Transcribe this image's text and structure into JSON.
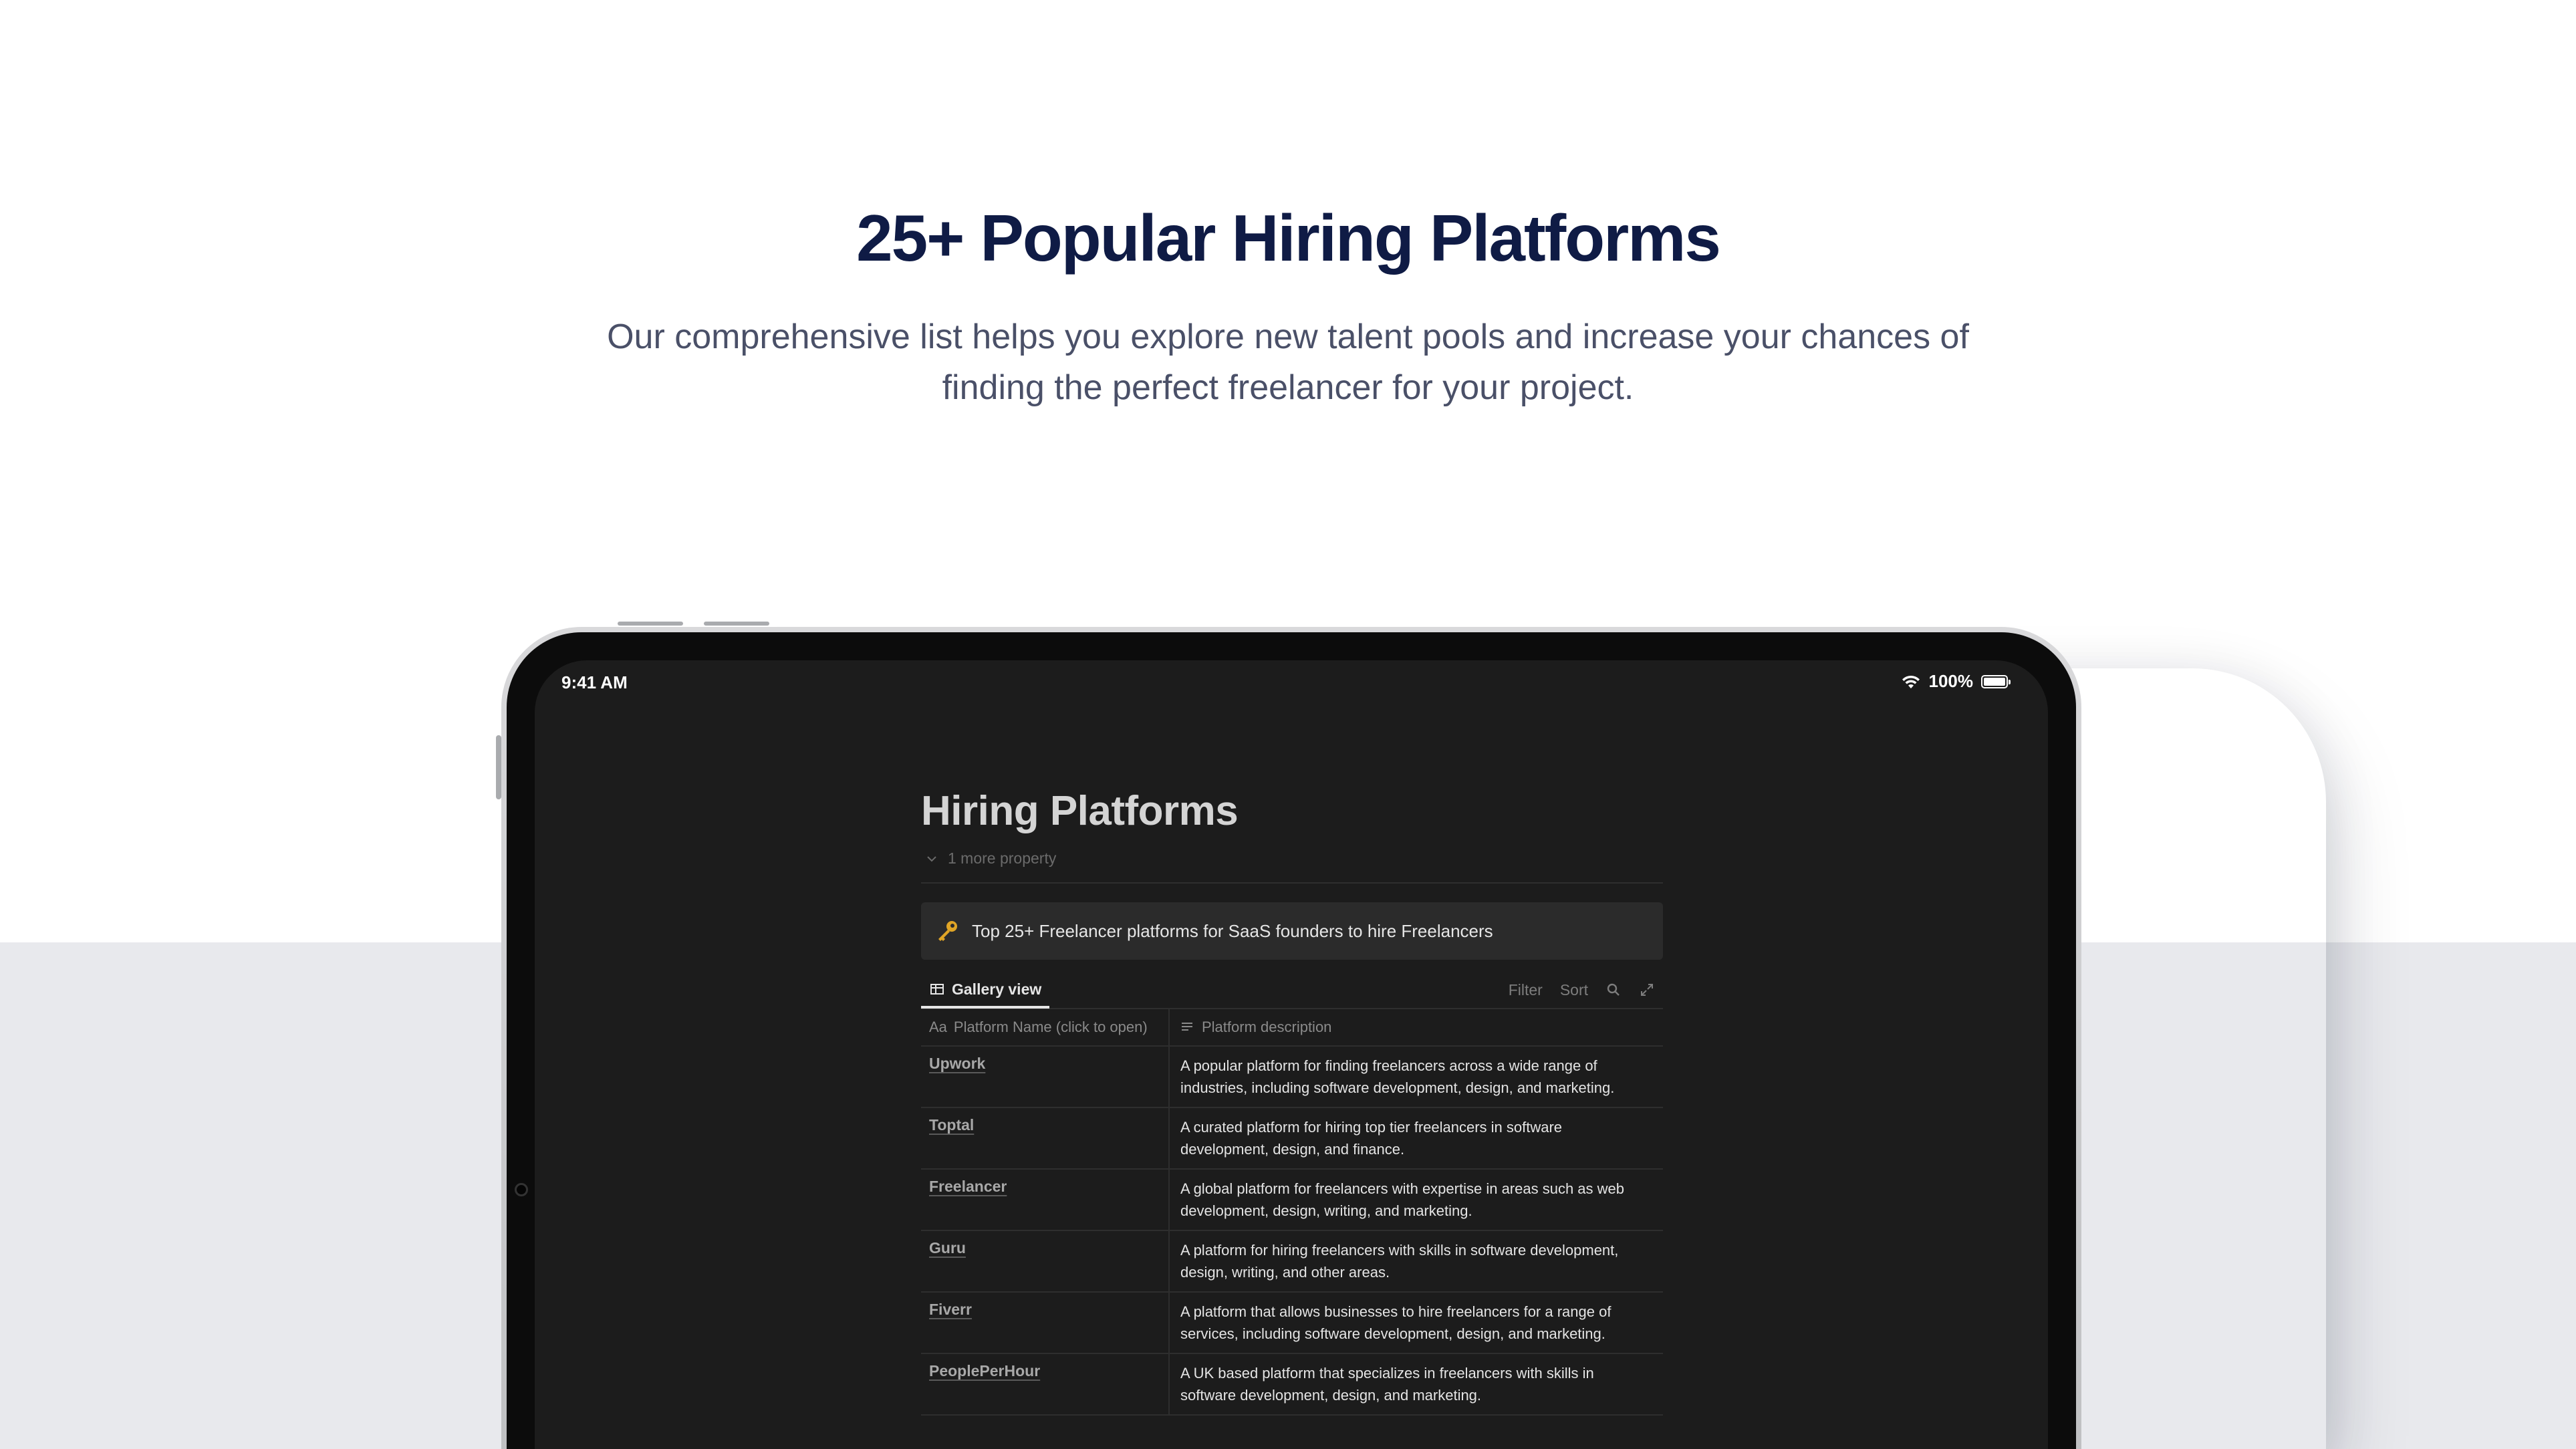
{
  "hero": {
    "title": "25+ Popular Hiring Platforms",
    "subtitle": "Our comprehensive list helps you explore new talent pools and increase your chances of finding the perfect freelancer for your project."
  },
  "status_bar": {
    "time": "9:41 AM",
    "battery": "100%"
  },
  "notion_page": {
    "title": "Hiring Platforms",
    "more_property": "1 more property",
    "callout": "Top 25+ Freelancer platforms for SaaS founders to hire Freelancers",
    "view_tab": "Gallery view",
    "actions": {
      "filter": "Filter",
      "sort": "Sort"
    },
    "columns": {
      "name_prefix": "Aa",
      "name": "Platform Name (click to open)",
      "description": "Platform description"
    },
    "rows": [
      {
        "name": "Upwork",
        "description": " A popular platform for finding freelancers across a wide range of industries, including software development, design, and marketing."
      },
      {
        "name": "Toptal",
        "description": " A curated platform for hiring top tier freelancers in software development, design, and finance."
      },
      {
        "name": "Freelancer",
        "description": " A global platform for freelancers with expertise in areas such as web development, design, writing, and marketing."
      },
      {
        "name": "Guru",
        "description": " A platform for hiring freelancers with skills in software development, design, writing, and other areas."
      },
      {
        "name": "Fiverr",
        "description": " A platform that allows businesses to hire freelancers for a range of services, including software development, design, and marketing."
      },
      {
        "name": "PeoplePerHour",
        "description": " A UK based platform that specializes in freelancers with skills in software development, design, and marketing."
      }
    ]
  },
  "colors": {
    "hero_title": "#0f1b45",
    "hero_subtitle": "#4a5068",
    "band": "#e8e9ed",
    "screen_bg": "#1c1c1c",
    "callout_bg": "#2b2b2b"
  },
  "icons": [
    "wifi-icon",
    "battery-icon",
    "chevron-down-icon",
    "key-icon",
    "table-icon",
    "search-icon",
    "expand-icon",
    "text-lines-icon"
  ]
}
